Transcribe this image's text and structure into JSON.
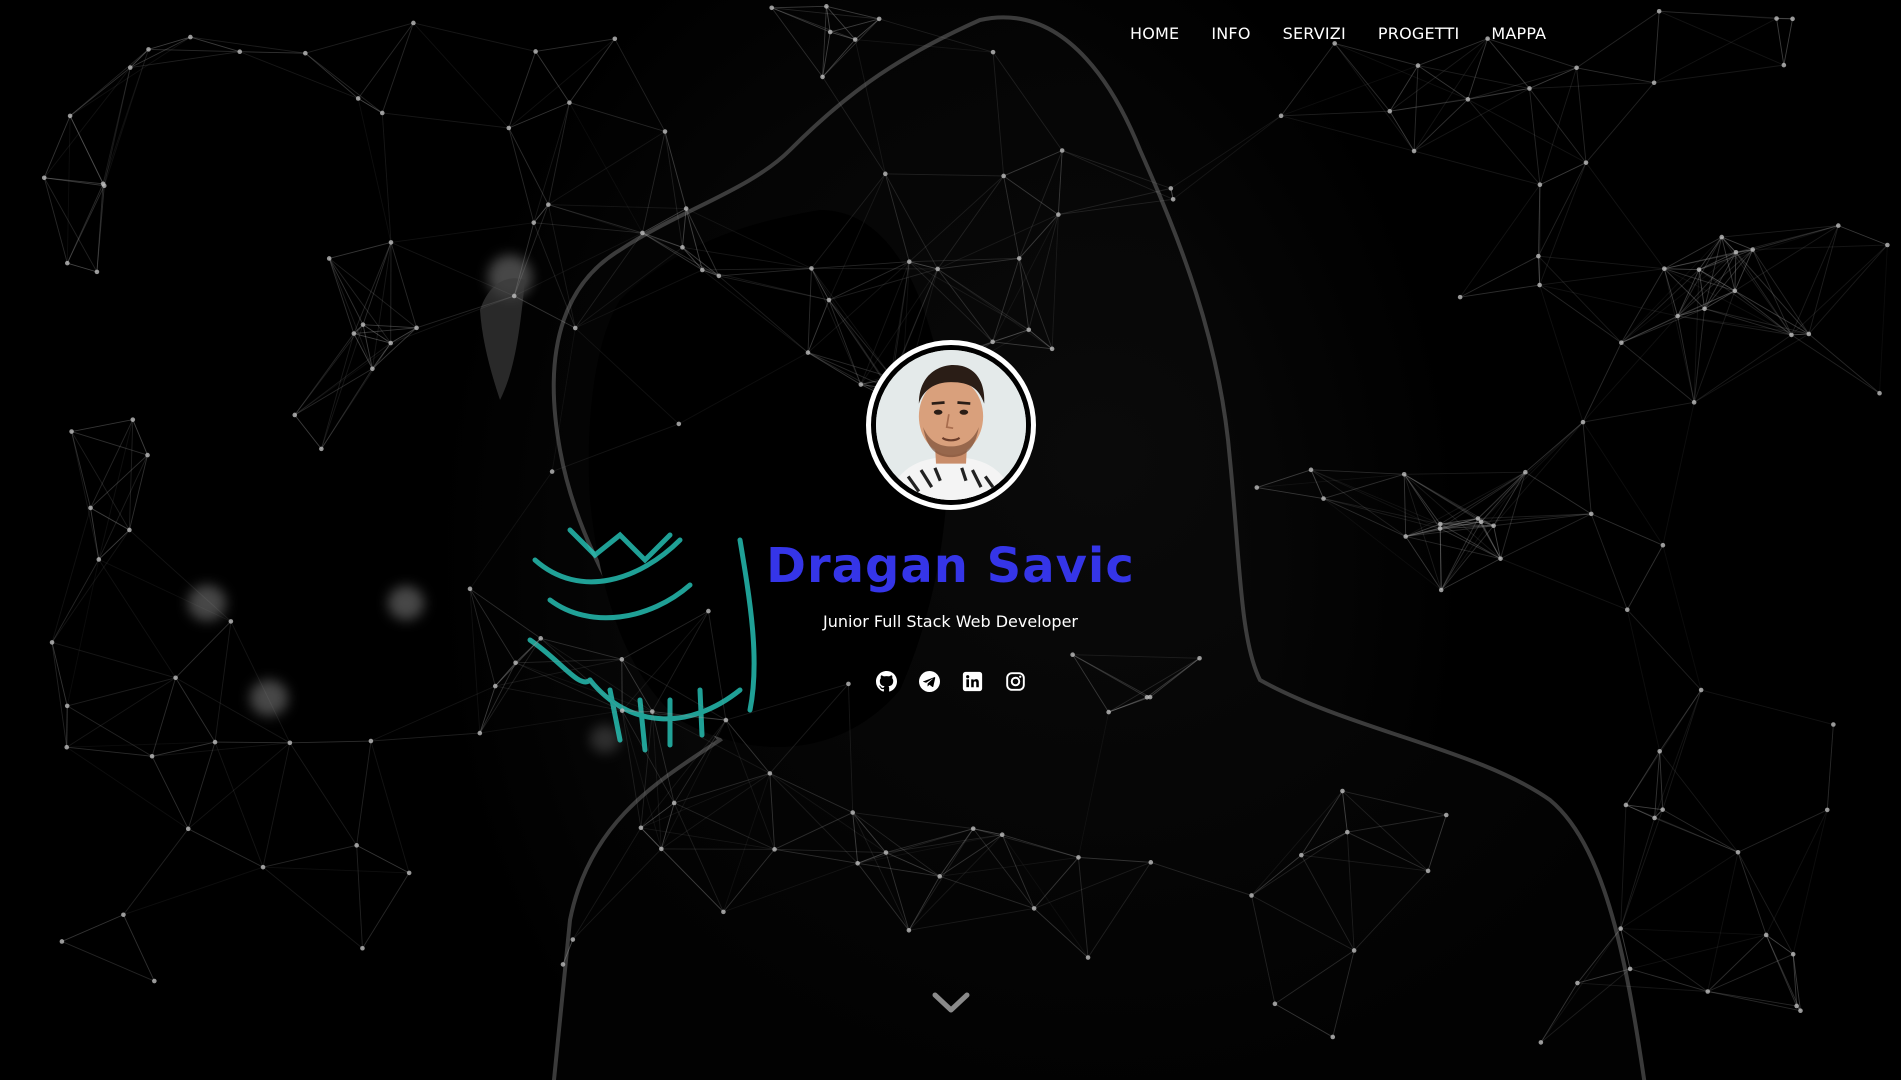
{
  "nav": {
    "items": [
      {
        "label": "HOME"
      },
      {
        "label": "INFO"
      },
      {
        "label": "SERVIZI"
      },
      {
        "label": "PROGETTI"
      },
      {
        "label": "MAPPA"
      }
    ]
  },
  "profile": {
    "name": "Dragan Savic",
    "tagline": "Junior Full Stack Web Developer"
  },
  "socials": [
    {
      "icon": "github-icon"
    },
    {
      "icon": "telegram-icon"
    },
    {
      "icon": "linkedin-icon"
    },
    {
      "icon": "instagram-icon"
    }
  ],
  "scroll": {
    "icon": "chevron-down-icon"
  },
  "colors": {
    "accent": "#3535e8",
    "mask_glow": "#2ad6c8",
    "background": "#000000",
    "text": "#ffffff"
  }
}
